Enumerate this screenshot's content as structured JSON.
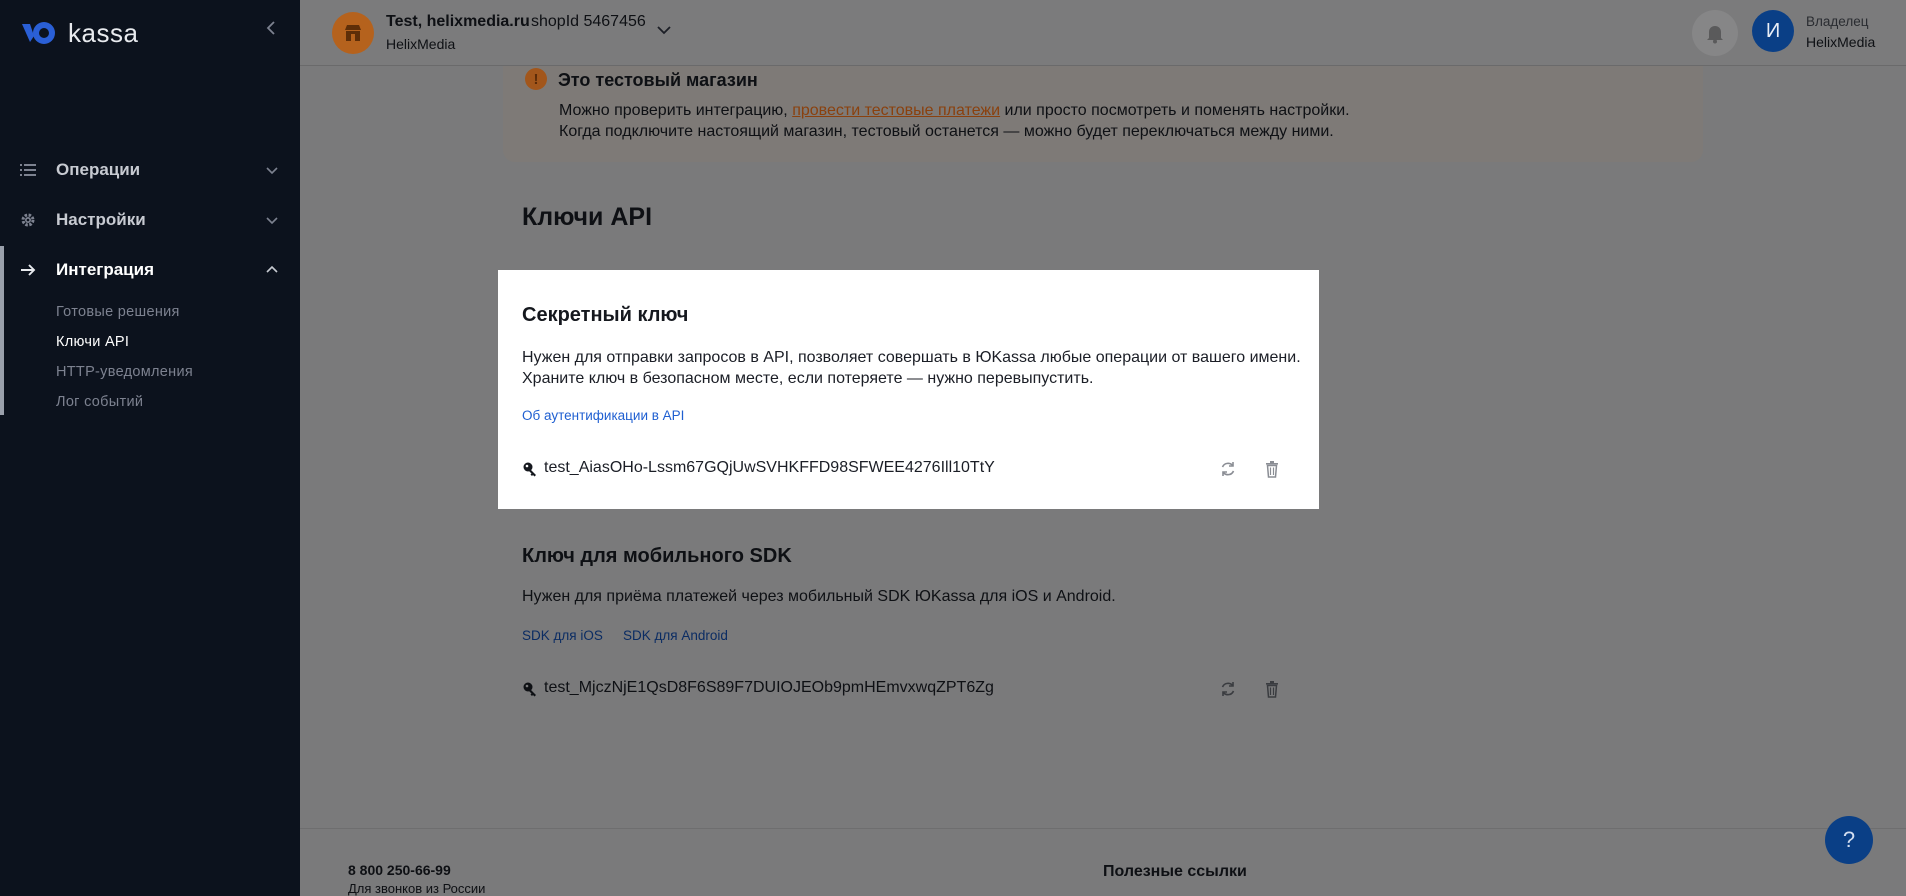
{
  "brand": {
    "logo_text": "kassa",
    "accent": "#0a3f86",
    "sidebar_bg": "#0c121d"
  },
  "sidebar": {
    "collapse_icon": "chevron-left-icon",
    "items": [
      {
        "label": "Операции",
        "icon": "list-icon",
        "expanded": false
      },
      {
        "label": "Настройки",
        "icon": "gear-icon",
        "expanded": false
      },
      {
        "label": "Интеграция",
        "icon": "arrow-right-icon",
        "expanded": true
      }
    ],
    "subitems": [
      {
        "label": "Готовые решения"
      },
      {
        "label": "Ключи API",
        "current": true
      },
      {
        "label": "HTTP-уведомления"
      },
      {
        "label": "Лог событий"
      }
    ]
  },
  "header": {
    "shop_name": "Test, helixmedia.ru",
    "shop_id": "shopId 5467456",
    "shop_org": "HelixMedia",
    "user_initial": "И",
    "user_role": "Владелец",
    "user_name": "HelixMedia"
  },
  "banner": {
    "title": "Это тестовый магазин",
    "line1_before": "Можно проверить интеграцию, ",
    "line1_link": "провести тестовые платежи",
    "line1_after": " или просто посмотреть и поменять настройки.",
    "line2": "Когда подключите настоящий магазин, тестовый останется — можно будет переключаться между ними."
  },
  "page": {
    "title": "Ключи API"
  },
  "secret_key": {
    "title": "Секретный ключ",
    "desc_line1": "Нужен для отправки запросов в API, позволяет совершать в ЮKassa любые операции от вашего имени.",
    "desc_line2": "Храните ключ в безопасном месте, если потеряете — нужно перевыпустить.",
    "link": "Об аутентификации в API",
    "value": "test_AiasOHo-Lssm67GQjUwSVHKFFD98SFWEE4276Ill10TtY"
  },
  "sdk_key": {
    "title": "Ключ для мобильного SDK",
    "desc": "Нужен для приёма платежей через мобильный SDK ЮKassa для iOS и Android.",
    "link_ios": "SDK для iOS",
    "link_android": "SDK для Android",
    "value": "test_MjczNjE1QsD8F6S89F7DUIOJEOb9pmHEmvxwqZPT6Zg"
  },
  "footer": {
    "phone": "8 800 250-66-99",
    "phone_sub": "Для звонков из России",
    "links_title": "Полезные ссылки"
  },
  "help": {
    "label": "?"
  }
}
